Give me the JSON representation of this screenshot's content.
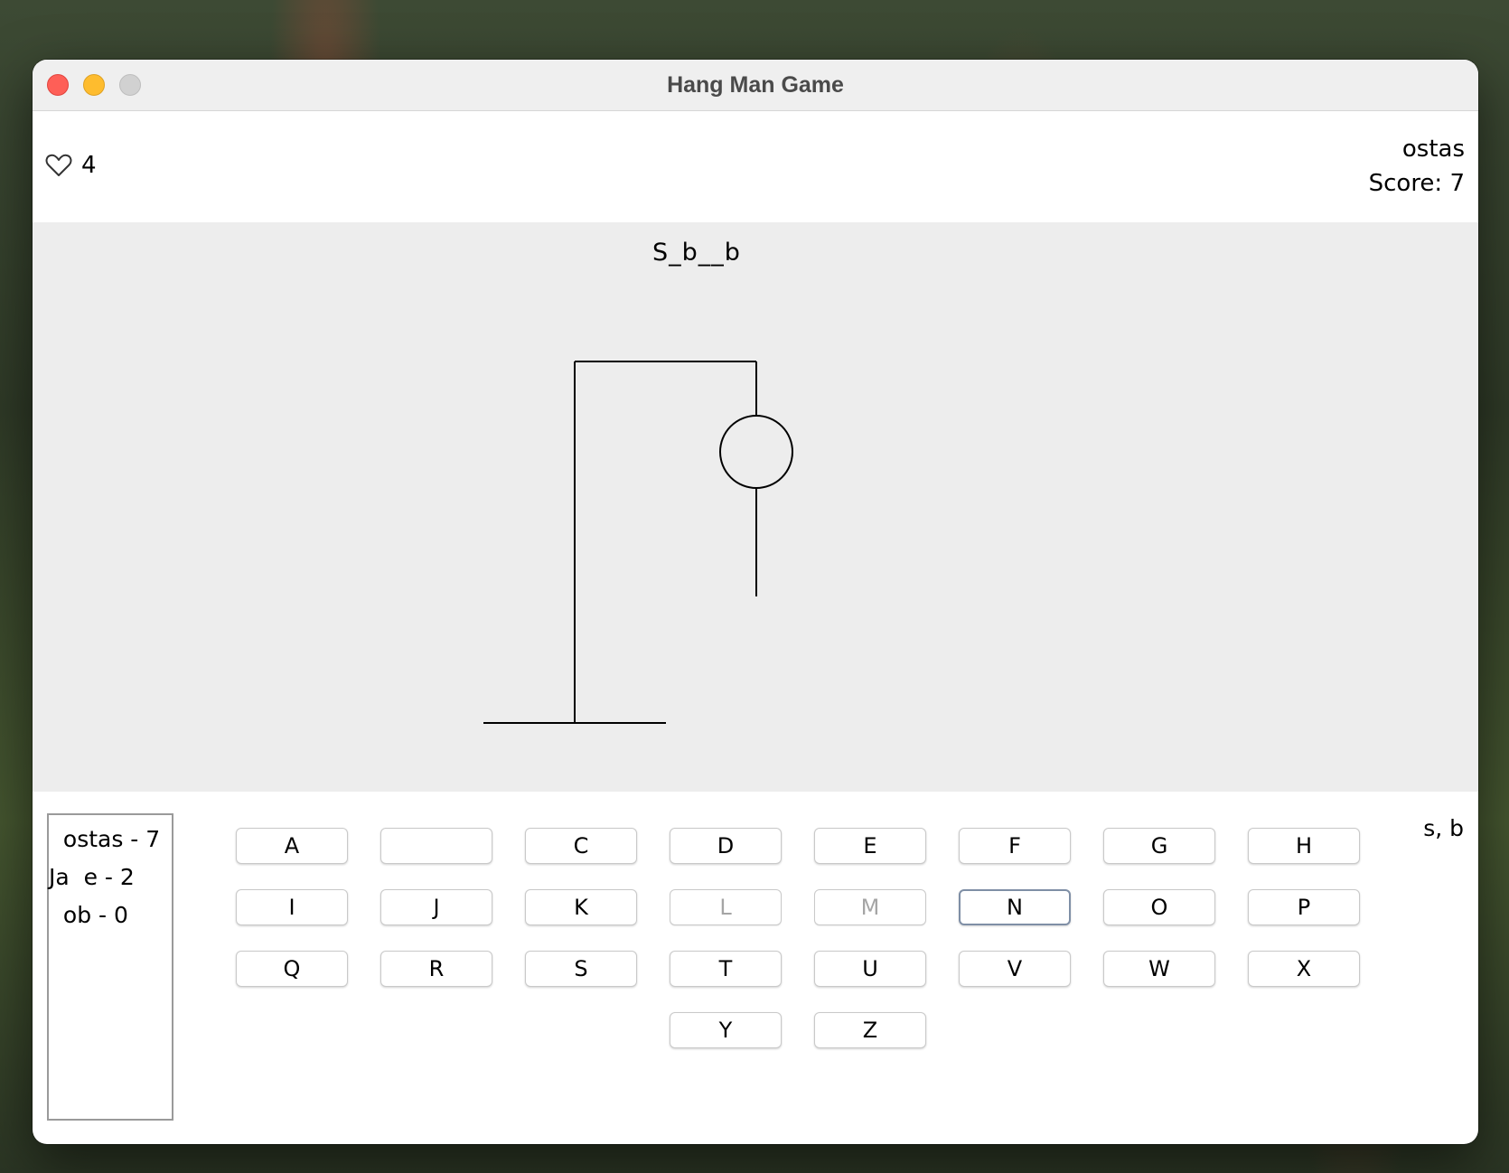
{
  "window": {
    "title": "Hang Man Game"
  },
  "status": {
    "lives": "4",
    "player_name": "ostas",
    "score_text": "Score: 7"
  },
  "game": {
    "masked_word": "S_b__b",
    "guessed_letters": "s, b"
  },
  "leaderboard": [
    "  ostas - 7",
    "Ja  e - 2",
    "  ob - 0"
  ],
  "keyboard": [
    {
      "label": "A",
      "state": "enabled"
    },
    {
      "label": "",
      "state": "enabled"
    },
    {
      "label": "C",
      "state": "enabled"
    },
    {
      "label": "D",
      "state": "enabled"
    },
    {
      "label": "E",
      "state": "enabled"
    },
    {
      "label": "F",
      "state": "enabled"
    },
    {
      "label": "G",
      "state": "enabled"
    },
    {
      "label": "H",
      "state": "enabled"
    },
    {
      "label": "I",
      "state": "enabled"
    },
    {
      "label": "J",
      "state": "enabled"
    },
    {
      "label": "K",
      "state": "enabled"
    },
    {
      "label": "L",
      "state": "disabled"
    },
    {
      "label": "M",
      "state": "disabled"
    },
    {
      "label": "N",
      "state": "focused"
    },
    {
      "label": "O",
      "state": "enabled"
    },
    {
      "label": "P",
      "state": "enabled"
    },
    {
      "label": "Q",
      "state": "enabled"
    },
    {
      "label": "R",
      "state": "enabled"
    },
    {
      "label": "S",
      "state": "enabled"
    },
    {
      "label": "T",
      "state": "enabled"
    },
    {
      "label": "U",
      "state": "enabled"
    },
    {
      "label": "V",
      "state": "enabled"
    },
    {
      "label": "W",
      "state": "enabled"
    },
    {
      "label": "X",
      "state": "enabled"
    },
    {
      "label": "Y",
      "state": "enabled"
    },
    {
      "label": "Z",
      "state": "enabled"
    }
  ],
  "icons": {
    "lives": "heart-outline-icon"
  }
}
